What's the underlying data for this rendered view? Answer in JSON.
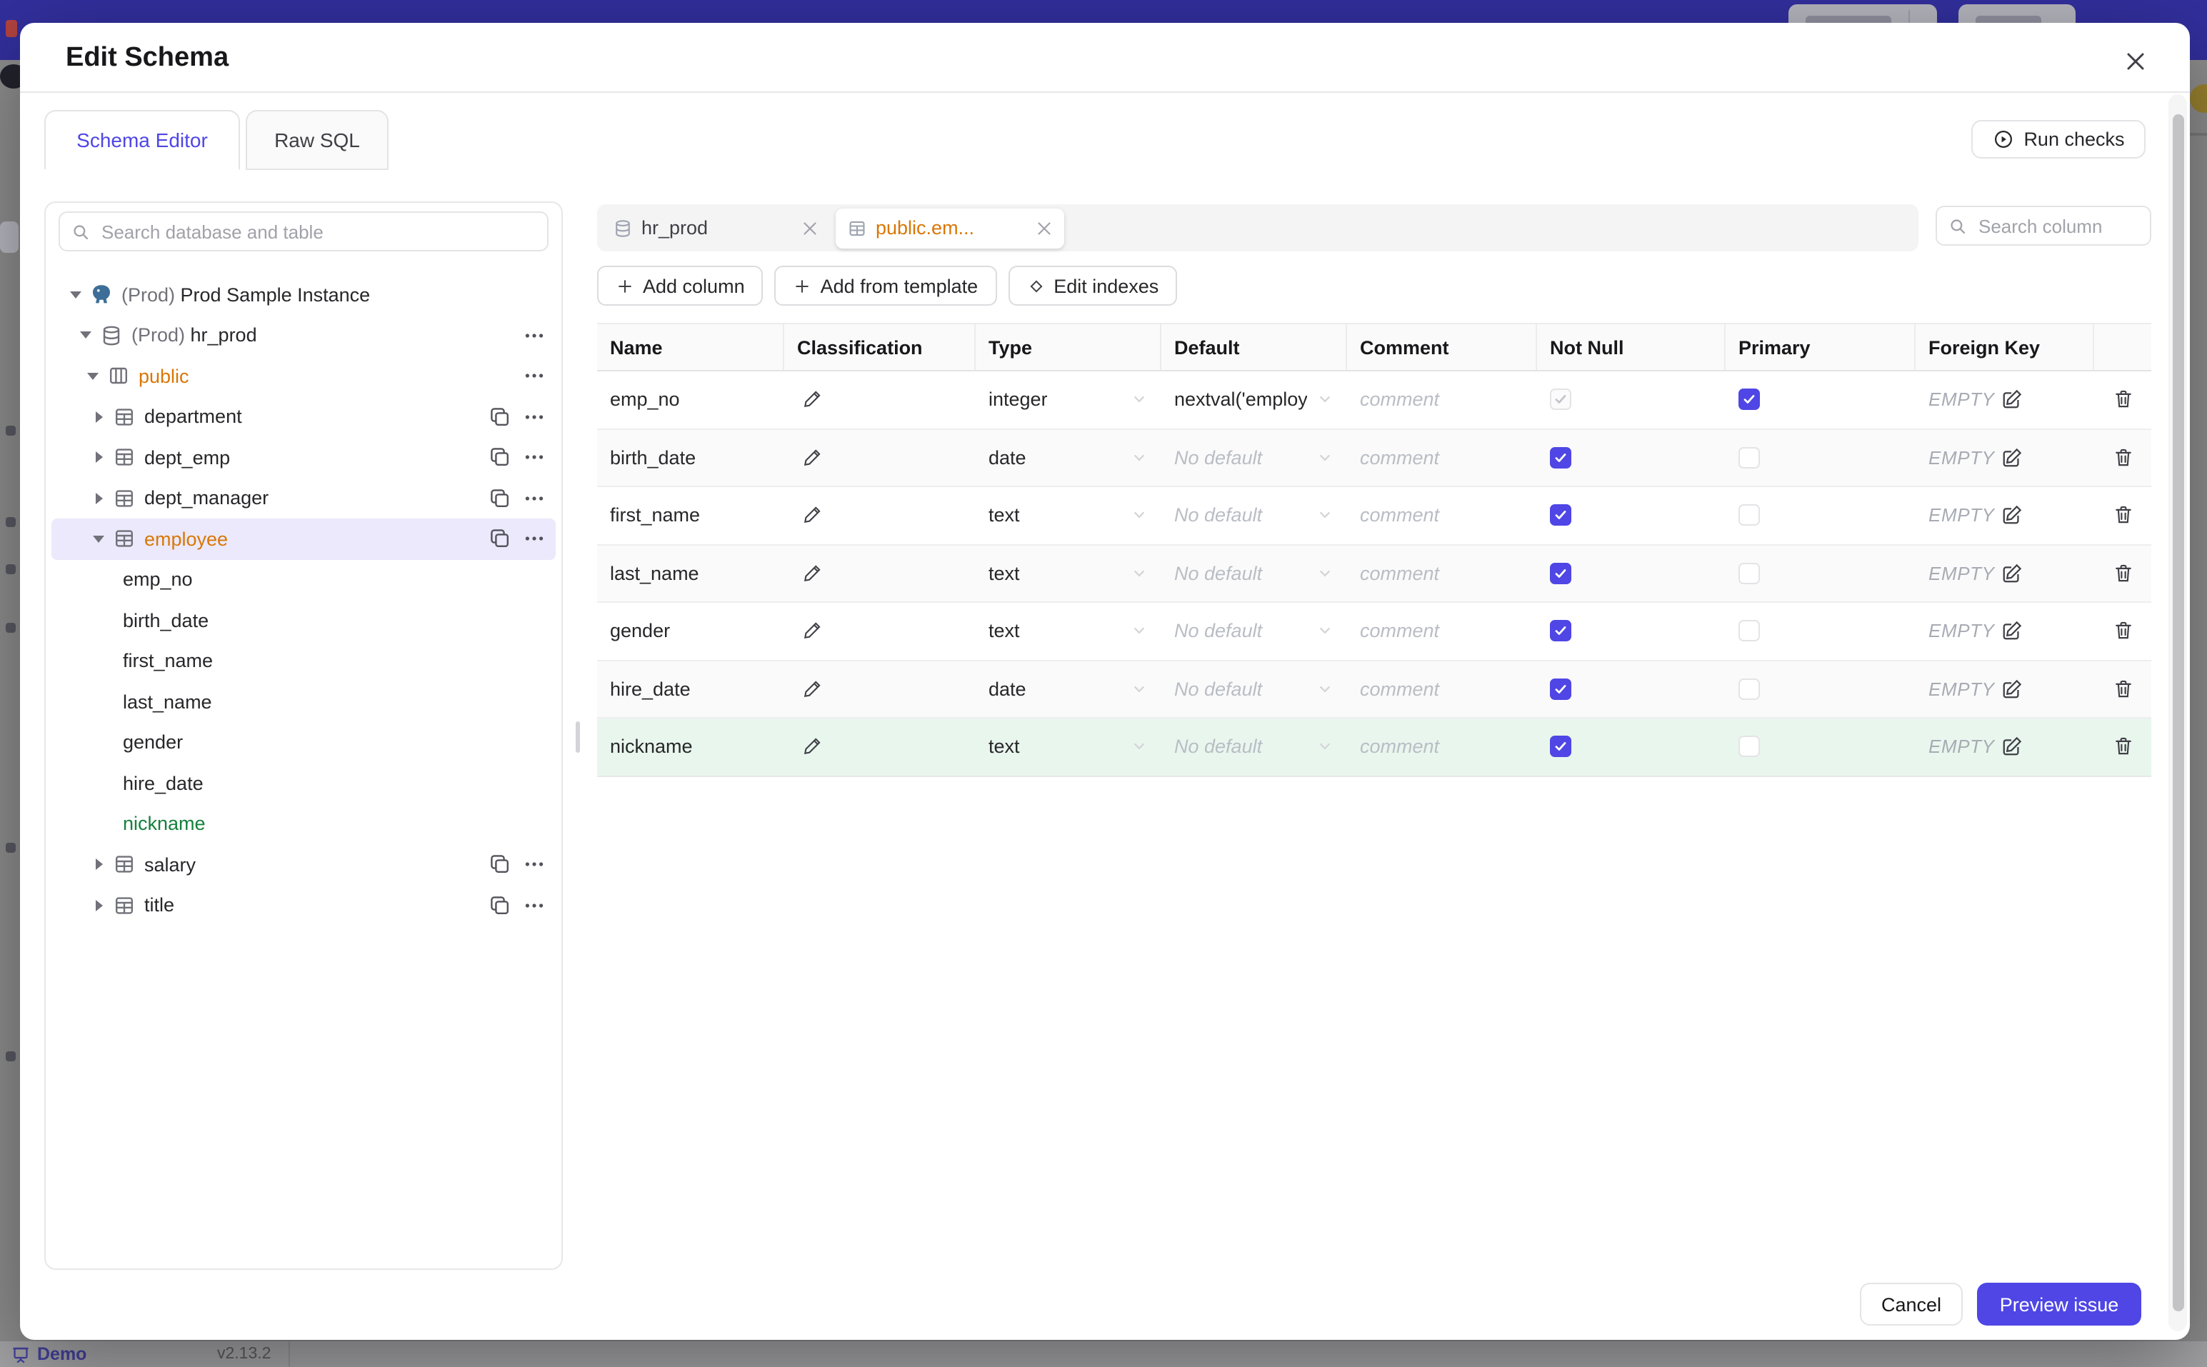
{
  "background": {
    "demo_label": "Demo",
    "version": "v2.13.2"
  },
  "modal": {
    "title": "Edit Schema",
    "tabs": [
      {
        "label": "Schema Editor",
        "active": true
      },
      {
        "label": "Raw SQL",
        "active": false
      }
    ],
    "run_checks_label": "Run checks",
    "footer": {
      "cancel_label": "Cancel",
      "primary_label": "Preview issue"
    }
  },
  "sidebar": {
    "search_placeholder": "Search database and table",
    "tree": [
      {
        "prefix": "(Prod) ",
        "label": "Prod Sample Instance",
        "icon": "postgres-icon",
        "level": 0,
        "expand": "open"
      },
      {
        "prefix": "(Prod) ",
        "label": "hr_prod",
        "icon": "database-icon",
        "level": 1,
        "expand": "open",
        "actions": [
          "more"
        ]
      },
      {
        "label": "public",
        "icon": "schema-icon",
        "level": 2,
        "expand": "open",
        "accent": "orange",
        "actions": [
          "more"
        ]
      },
      {
        "label": "department",
        "icon": "table-icon",
        "level": 3,
        "expand": "closed",
        "actions": [
          "copy",
          "more"
        ]
      },
      {
        "label": "dept_emp",
        "icon": "table-icon",
        "level": 3,
        "expand": "closed",
        "actions": [
          "copy",
          "more"
        ]
      },
      {
        "label": "dept_manager",
        "icon": "table-icon",
        "level": 3,
        "expand": "closed",
        "actions": [
          "copy",
          "more"
        ]
      },
      {
        "label": "employee",
        "icon": "table-icon",
        "level": 3,
        "expand": "open",
        "accent": "orange",
        "selected": true,
        "actions": [
          "copy",
          "more"
        ]
      },
      {
        "label": "emp_no",
        "level": 4
      },
      {
        "label": "birth_date",
        "level": 4
      },
      {
        "label": "first_name",
        "level": 4
      },
      {
        "label": "last_name",
        "level": 4
      },
      {
        "label": "gender",
        "level": 4
      },
      {
        "label": "hire_date",
        "level": 4
      },
      {
        "label": "nickname",
        "level": 4,
        "accent": "green"
      },
      {
        "label": "salary",
        "icon": "table-icon",
        "level": 3,
        "expand": "closed",
        "actions": [
          "copy",
          "more"
        ]
      },
      {
        "label": "title",
        "icon": "table-icon",
        "level": 3,
        "expand": "closed",
        "actions": [
          "copy",
          "more"
        ]
      }
    ]
  },
  "editor": {
    "chips": [
      {
        "label": "hr_prod",
        "icon": "database-icon",
        "active": false
      },
      {
        "label": "public.em...",
        "icon": "table-icon",
        "active": true
      }
    ],
    "search_placeholder": "Search column",
    "toolbar": [
      {
        "label": "Add column",
        "icon": "plus-icon"
      },
      {
        "label": "Add from template",
        "icon": "plus-icon"
      },
      {
        "label": "Edit indexes",
        "icon": "diamond-icon"
      }
    ],
    "table": {
      "headers": [
        "Name",
        "Classification",
        "Type",
        "Default",
        "Comment",
        "Not Null",
        "Primary",
        "Foreign Key"
      ],
      "comment_placeholder": "comment",
      "foreign_key_empty": "EMPTY",
      "rows": [
        {
          "name": "emp_no",
          "type": "integer",
          "default": "nextval('employ",
          "default_placeholder": false,
          "not_null": "checked-disabled",
          "primary": "checked",
          "added": false
        },
        {
          "name": "birth_date",
          "type": "date",
          "default": "No default",
          "default_placeholder": true,
          "not_null": "checked",
          "primary": "unchecked",
          "added": false
        },
        {
          "name": "first_name",
          "type": "text",
          "default": "No default",
          "default_placeholder": true,
          "not_null": "checked",
          "primary": "unchecked",
          "added": false
        },
        {
          "name": "last_name",
          "type": "text",
          "default": "No default",
          "default_placeholder": true,
          "not_null": "checked",
          "primary": "unchecked",
          "added": false
        },
        {
          "name": "gender",
          "type": "text",
          "default": "No default",
          "default_placeholder": true,
          "not_null": "checked",
          "primary": "unchecked",
          "added": false
        },
        {
          "name": "hire_date",
          "type": "date",
          "default": "No default",
          "default_placeholder": true,
          "not_null": "checked",
          "primary": "unchecked",
          "added": false
        },
        {
          "name": "nickname",
          "type": "text",
          "default": "No default",
          "default_placeholder": true,
          "not_null": "checked",
          "primary": "unchecked",
          "added": true
        }
      ]
    }
  },
  "colors": {
    "accent": "#4f46e5",
    "banner": "#322f9d",
    "selected_table_orange": "#d97706",
    "added_green": "#15803d",
    "added_row_bg": "#e9f6ee"
  }
}
